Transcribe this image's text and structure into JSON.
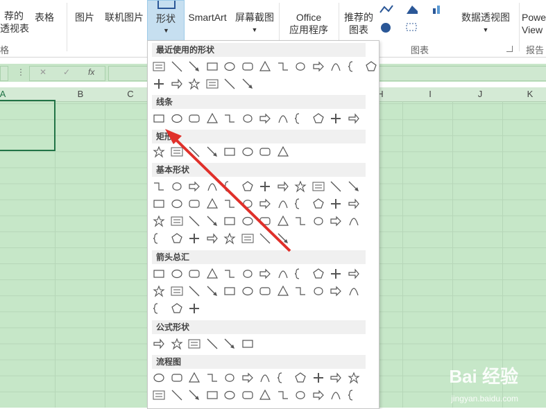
{
  "ribbon": {
    "buttons": [
      {
        "id": "pivot",
        "label": "荐的\n透视表"
      },
      {
        "id": "table",
        "label": "表格"
      },
      {
        "id": "pictures",
        "label": "图片"
      },
      {
        "id": "online",
        "label": "联机图片"
      },
      {
        "id": "shapes",
        "label": "形状"
      },
      {
        "id": "smartart",
        "label": "SmartArt"
      },
      {
        "id": "screenshot",
        "label": "屏幕截图"
      },
      {
        "id": "office",
        "label": "Office\n应用程序"
      },
      {
        "id": "recommended",
        "label": "推荐的\n图表"
      },
      {
        "id": "pivotchart",
        "label": "数据透视图"
      },
      {
        "id": "power",
        "label": "Powe\nView"
      }
    ],
    "groups": {
      "tables": "格",
      "charts": "图表",
      "reports": "报告"
    }
  },
  "formula_bar": {
    "fx": "fx"
  },
  "columns": [
    "A",
    "B",
    "C",
    "H",
    "I",
    "J",
    "K"
  ],
  "menu": {
    "sections": [
      {
        "title": "最近使用的形状"
      },
      {
        "title": "线条"
      },
      {
        "title": "矩形"
      },
      {
        "title": "基本形状"
      },
      {
        "title": "箭头总汇"
      },
      {
        "title": "公式形状"
      },
      {
        "title": "流程图"
      }
    ]
  },
  "watermark": {
    "brand": "Bai 经验",
    "url": "jingyan.baidu.com"
  },
  "colors": {
    "accent": "#217346",
    "sheet": "#c6e7c8",
    "annotation": "#e0302a"
  }
}
